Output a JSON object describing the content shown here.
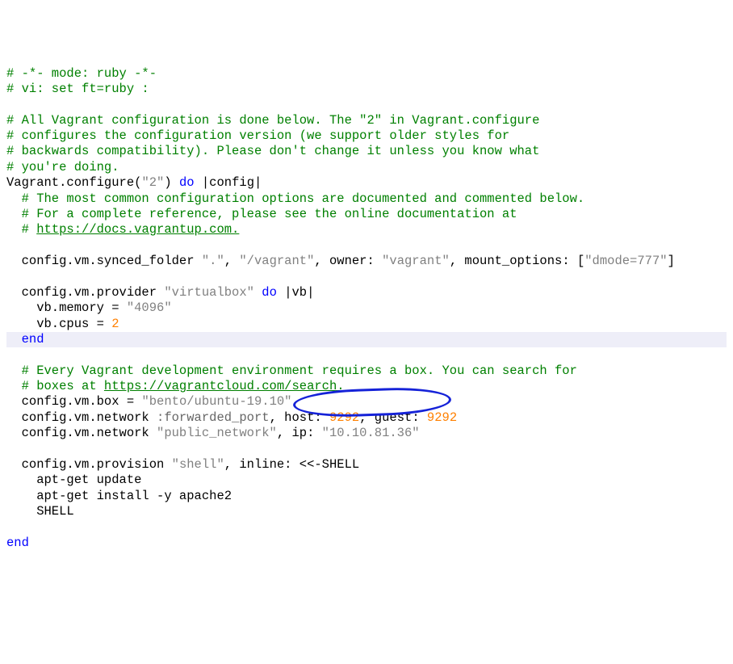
{
  "l1": "# -*- mode: ruby -*-",
  "l2": "# vi: set ft=ruby :",
  "l4": "# All Vagrant configuration is done below. The \"2\" in Vagrant.configure",
  "l5": "# configures the configuration version (we support older styles for",
  "l6": "# backwards compatibility). Please don't change it unless you know what",
  "l7": "# you're doing.",
  "vagrant": "Vagrant",
  "configure": ".configure(",
  "two": "\"2\"",
  "paren_do": ") ",
  "kw_do": "do",
  "pipe_config": " |config|",
  "l9": "  # The most common configuration options are documented and commented below.",
  "l10": "  # For a complete reference, please see the online documentation at",
  "l11a": "  # ",
  "l11b": "https://docs.vagrantup.com.",
  "l13a": "  config.vm.synced_folder ",
  "dot": "\".\"",
  "comma_sp": ", ",
  "vagrant_path": "\"/vagrant\"",
  "owner_lbl": ", owner: ",
  "owner_val": "\"vagrant\"",
  "mount_lbl": ", mount_options: [",
  "mount_val": "\"dmode=777\"",
  "close_br": "]",
  "l15a": "  config.vm.provider ",
  "vbox": "\"virtualbox\"",
  "sp_do": " ",
  "pipe_vb": " |vb|",
  "mem_a": "    vb.memory = ",
  "mem_v": "\"4096\"",
  "cpu_a": "    vb.cpus = ",
  "cpu_v": "2",
  "end1": "  end",
  "l20": "  # Every Vagrant development environment requires a box. You can search for",
  "l21a": "  # boxes at ",
  "l21b": "https://vagrantcloud.com/search.",
  "box_a": "  config.vm.box = ",
  "box_v": "\"bento/ubuntu-19.10\"",
  "net1_a": "  config.vm.network ",
  "net1_sym": ":forwarded_port",
  "net1_host": ", host: ",
  "port1": "9292",
  "net1_guest": ", guest: ",
  "port2": "9292",
  "net2_a": "  config.vm.network ",
  "pubnet": "\"public_network\"",
  "ip_lbl": ", ip: ",
  "ip_val": "\"10.10.81.36\"",
  "prov_a": "  config.vm.provision ",
  "shell_s": "\"shell\"",
  "inline_lbl": ", inline: ",
  "heredoc_open": "<<-SHELL",
  "sh1": "    apt-get update",
  "sh2": "    apt-get install -y apache2",
  "sh3": "    SHELL",
  "end2": "end"
}
